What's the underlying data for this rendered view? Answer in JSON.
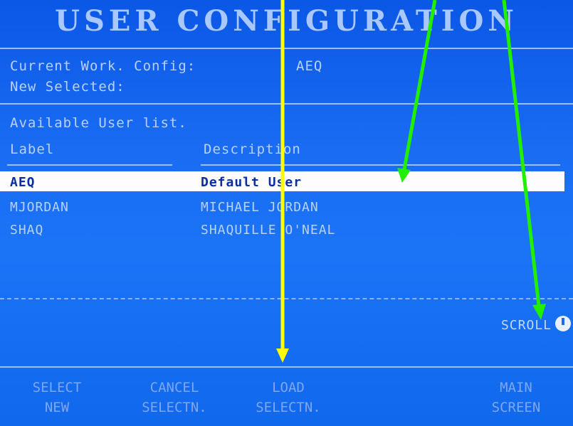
{
  "screen": {
    "title": "USER CONFIGURATION",
    "current_config_label": "Current Work. Config:",
    "current_config_value": "AEQ",
    "new_selected_label": "New Selected:",
    "available_list_label": "Available User list.",
    "col_label": "Label",
    "col_description": "Description",
    "users": [
      {
        "label": "AEQ",
        "description": "Default User",
        "selected": true
      },
      {
        "label": "MJORDAN",
        "description": "MICHAEL JORDAN",
        "selected": false
      },
      {
        "label": "SHAQ",
        "description": "SHAQUILLE O'NEAL",
        "selected": false
      }
    ],
    "scroll_label": "SCROLL",
    "scroll_icon": "scroll-knob-icon"
  },
  "softkeys": [
    {
      "line1": "SELECT",
      "line2": "NEW"
    },
    {
      "line1": "CANCEL",
      "line2": "SELECTN."
    },
    {
      "line1": "LOAD",
      "line2": "SELECTN."
    },
    {
      "line1": "MAIN",
      "line2": "SCREEN"
    }
  ],
  "annotations": {
    "yellow_arrow_color": "#ffff00",
    "green_arrow_color": "#22ee00"
  }
}
